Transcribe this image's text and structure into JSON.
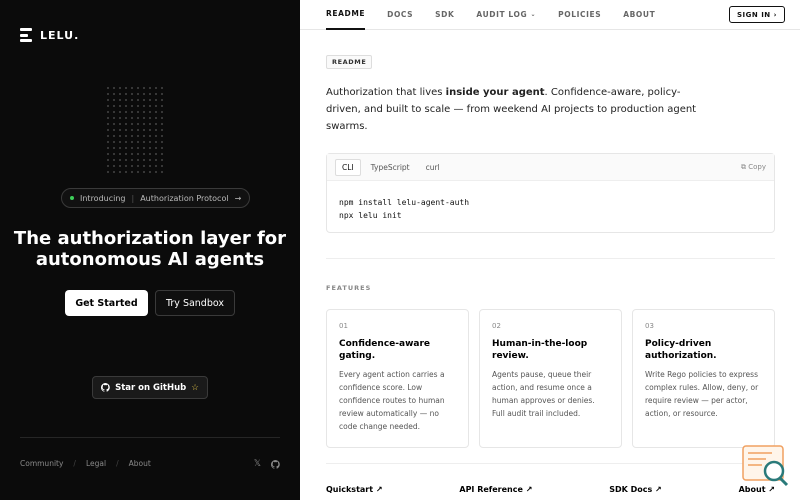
{
  "brand": {
    "name": "LELU."
  },
  "hero": {
    "pill_intro": "Introducing",
    "pill_label": "Authorization Protocol",
    "headline_line1": "The authorization layer for",
    "headline_line2": "autonomous AI agents",
    "get_started": "Get Started",
    "try_sandbox": "Try Sandbox",
    "github": "Star on GitHub"
  },
  "left_footer": {
    "links": [
      "Community",
      "Legal",
      "About"
    ]
  },
  "nav": {
    "tabs": [
      "README",
      "DOCS",
      "SDK",
      "AUDIT LOG",
      "POLICIES",
      "ABOUT"
    ],
    "signin": "SIGN IN ›"
  },
  "readme": {
    "badge": "README",
    "intro_pre": "Authorization that lives ",
    "intro_bold": "inside your agent",
    "intro_post": ". Confidence-aware, policy-driven, and built to scale — from weekend AI projects to production agent swarms."
  },
  "code": {
    "tabs": [
      "CLI",
      "TypeScript",
      "curl"
    ],
    "copy": "Copy",
    "lines": [
      "npm install lelu-agent-auth",
      "npx lelu init"
    ]
  },
  "features": {
    "label": "FEATURES",
    "cards": [
      {
        "num": "01",
        "title": "Confidence-aware gating.",
        "desc": "Every agent action carries a confidence score. Low confidence routes to human review automatically — no code change needed."
      },
      {
        "num": "02",
        "title": "Human-in-the-loop review.",
        "desc": "Agents pause, queue their action, and resume once a human approves or denies. Full audit trail included."
      },
      {
        "num": "03",
        "title": "Policy-driven authorization.",
        "desc": "Write Rego policies to express complex rules. Allow, deny, or require review — per actor, action, or resource."
      }
    ]
  },
  "bottom_links": [
    "Quickstart ↗",
    "API Reference ↗",
    "SDK Docs ↗",
    "About ↗"
  ]
}
